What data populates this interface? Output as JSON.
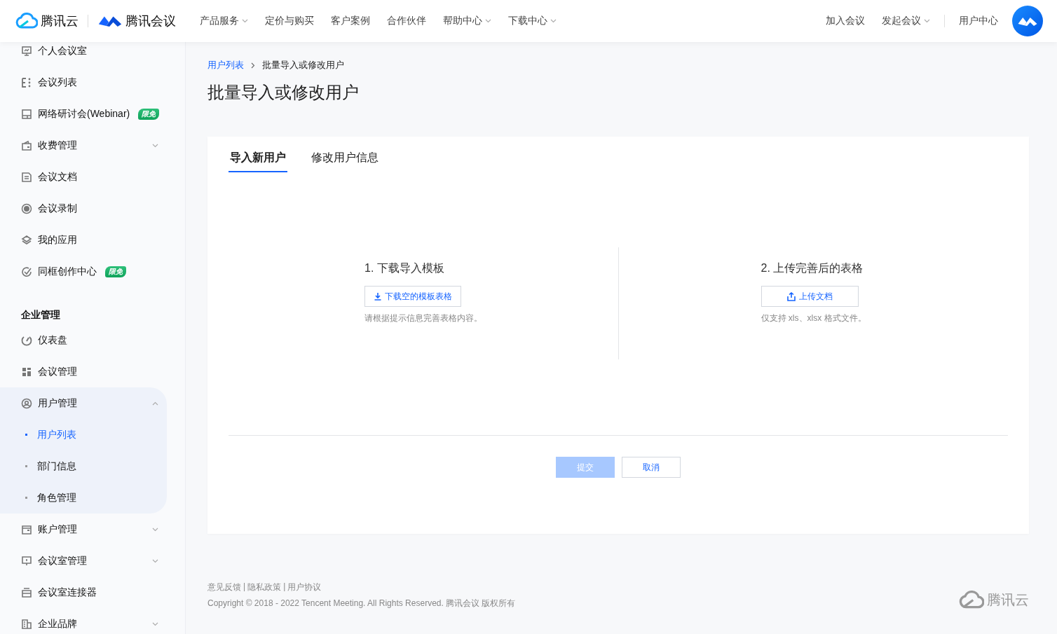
{
  "header": {
    "logos": [
      {
        "kind": "cloud",
        "text": "腾讯云"
      },
      {
        "kind": "meeting",
        "text": "腾讯会议"
      }
    ],
    "nav": [
      {
        "label": "产品服务",
        "dropdown": true
      },
      {
        "label": "定价与购买",
        "dropdown": false
      },
      {
        "label": "客户案例",
        "dropdown": false
      },
      {
        "label": "合作伙伴",
        "dropdown": false
      },
      {
        "label": "帮助中心",
        "dropdown": true
      },
      {
        "label": "下载中心",
        "dropdown": true
      }
    ],
    "right_nav": [
      {
        "label": "加入会议",
        "dropdown": false
      },
      {
        "label": "发起会议",
        "dropdown": true
      },
      {
        "label": "用户中心",
        "dropdown": false
      }
    ]
  },
  "sidebar": {
    "items": [
      {
        "kind": "link",
        "label": "个人会议室",
        "selected": false
      },
      {
        "kind": "link",
        "label": "会议列表",
        "selected": false
      },
      {
        "kind": "link",
        "label": "网络研讨会(Webinar)",
        "badge": "限免",
        "selected": false
      },
      {
        "kind": "group",
        "label": "收费管理",
        "expanded": false
      },
      {
        "kind": "link",
        "label": "会议文档",
        "selected": false
      },
      {
        "kind": "link",
        "label": "会议录制",
        "selected": false
      },
      {
        "kind": "link",
        "label": "我的应用",
        "selected": false
      },
      {
        "kind": "link",
        "label": "同框创作中心",
        "badge": "限免",
        "selected": false
      },
      {
        "kind": "heading",
        "label": "企业管理"
      },
      {
        "kind": "link",
        "label": "仪表盘",
        "selected": false
      },
      {
        "kind": "link",
        "label": "会议管理",
        "selected": false
      },
      {
        "kind": "group",
        "label": "用户管理",
        "expanded": true,
        "children": [
          {
            "label": "用户列表",
            "selected": true
          },
          {
            "label": "部门信息",
            "selected": false
          },
          {
            "label": "角色管理",
            "selected": false
          }
        ]
      },
      {
        "kind": "group",
        "label": "账户管理",
        "expanded": false
      },
      {
        "kind": "group",
        "label": "会议室管理",
        "expanded": false
      },
      {
        "kind": "link",
        "label": "会议室连接器",
        "selected": false
      },
      {
        "kind": "group",
        "label": "企业品牌",
        "expanded": false
      }
    ]
  },
  "main": {
    "breadcrumb": [
      {
        "label": "用户列表",
        "link": true
      },
      {
        "label": "批量导入或修改用户",
        "link": false
      }
    ],
    "title": "批量导入或修改用户",
    "tabs": [
      {
        "label": "导入新用户",
        "selected": true
      },
      {
        "label": "修改用户信息",
        "selected": false
      }
    ],
    "steps": [
      {
        "title": "1. 下载导入模板",
        "button": {
          "kind": "download",
          "label": "下载空的模板表格"
        },
        "hint": "请根据提示信息完善表格内容。"
      },
      {
        "title": "2. 上传完善后的表格",
        "button": {
          "kind": "upload",
          "label": "上传文档"
        },
        "hint": "仅支持 xls、xlsx 格式文件。"
      }
    ],
    "actions": [
      {
        "kind": "primary",
        "label": "提交",
        "disabled": true
      },
      {
        "kind": "default",
        "label": "取消",
        "disabled": false
      }
    ]
  },
  "footer": {
    "links": [
      "意见反馈",
      "隐私政策",
      "用户协议"
    ],
    "separator": "|",
    "copyright": "Copyright © 2018 - 2022 Tencent Meeting. All Rights Reserved. 腾讯会议 版权所有",
    "logo_text": "腾讯云"
  }
}
